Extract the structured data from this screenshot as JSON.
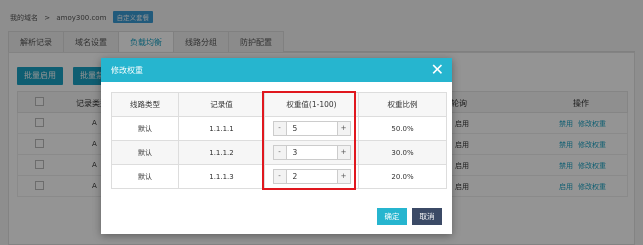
{
  "breadcrumb": {
    "root": "我的域名",
    "separator": ">",
    "domain": "amoy300.com",
    "badge": "自定义套餐"
  },
  "tabs": [
    {
      "label": "解析记录"
    },
    {
      "label": "域名设置"
    },
    {
      "label": "负载均衡"
    },
    {
      "label": "线路分组"
    },
    {
      "label": "防护配置"
    }
  ],
  "toolbar": {
    "batch_enable": "批量启用",
    "batch_disable_partial": "批量禁"
  },
  "background_table": {
    "headers": {
      "record_type": "记录类型",
      "polling": "权轮询",
      "actions": "操作"
    },
    "rows": [
      {
        "type": "A",
        "polling": "启用",
        "action1": "禁用",
        "action2": "修改权重"
      },
      {
        "type": "A",
        "polling": "启用",
        "action1": "禁用",
        "action2": "修改权重"
      },
      {
        "type": "A",
        "polling": "启用",
        "action1": "禁用",
        "action2": "修改权重"
      },
      {
        "type": "A",
        "polling": "启用",
        "action1": "启用",
        "action2": "修改权重"
      }
    ]
  },
  "modal": {
    "title": "修改权重",
    "close_symbol": "✕",
    "headers": {
      "line_type": "线路类型",
      "record_value": "记录值",
      "weight": "权重值(1-100)",
      "ratio": "权重比例"
    },
    "rows": [
      {
        "line_type": "默认",
        "record_value": "1.1.1.1",
        "weight": "5",
        "ratio": "50.0%"
      },
      {
        "line_type": "默认",
        "record_value": "1.1.1.2",
        "weight": "3",
        "ratio": "30.0%"
      },
      {
        "line_type": "默认",
        "record_value": "1.1.1.3",
        "weight": "2",
        "ratio": "20.0%"
      }
    ],
    "minus": "-",
    "plus": "+",
    "confirm": "确定",
    "cancel": "取消"
  },
  "colors": {
    "accent": "#26b5cf",
    "highlight": "#e0171e",
    "cancel": "#3b4a66"
  }
}
